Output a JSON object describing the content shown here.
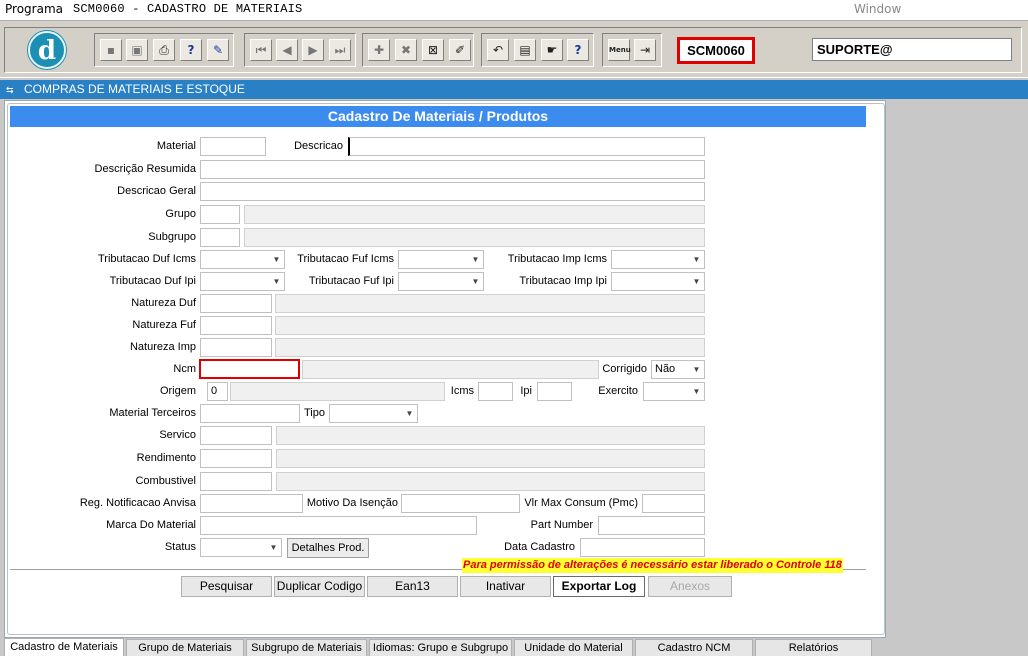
{
  "menubar": {
    "programa": "Programa",
    "title": "SCM0060 - CADASTRO DE MATERIAIS",
    "window": "Window"
  },
  "toolbar": {
    "logo_letter": "d",
    "buttons": [
      {
        "icon": "save-icon",
        "glyph": "▪"
      },
      {
        "icon": "screen-icon",
        "glyph": "▣"
      },
      {
        "icon": "print-icon",
        "glyph": "⎙"
      },
      {
        "icon": "query-icon",
        "glyph": "?"
      },
      {
        "icon": "execute-query-icon",
        "glyph": "✎"
      },
      {
        "icon": "first-record-icon",
        "glyph": "⏮"
      },
      {
        "icon": "previous-record-icon",
        "glyph": "◀"
      },
      {
        "icon": "next-record-icon",
        "glyph": "▶"
      },
      {
        "icon": "last-record-icon",
        "glyph": "⏭"
      },
      {
        "icon": "insert-record-icon",
        "glyph": "✚"
      },
      {
        "icon": "delete-record-icon",
        "glyph": "✖"
      },
      {
        "icon": "clear-record-icon",
        "glyph": "⊠"
      },
      {
        "icon": "edit-icon",
        "glyph": "✐"
      },
      {
        "icon": "undo-icon",
        "glyph": "↶"
      },
      {
        "icon": "clipboard-icon",
        "glyph": "▤"
      },
      {
        "icon": "hand-icon",
        "glyph": "☛"
      },
      {
        "icon": "help-icon",
        "glyph": "?"
      },
      {
        "icon": "menu-icon",
        "glyph": "Menu"
      },
      {
        "icon": "exit-icon",
        "glyph": "⇥"
      }
    ],
    "screen_code": "SCM0060",
    "user": "SUPORTE@"
  },
  "module_bar": {
    "title": "COMPRAS DE MATERIAIS E ESTOQUE"
  },
  "form": {
    "title": "Cadastro De Materiais / Produtos",
    "labels": {
      "material": "Material",
      "descricao": "Descricao",
      "descricao_resumida": "Descrição Resumida",
      "descricao_geral": "Descricao Geral",
      "grupo": "Grupo",
      "subgrupo": "Subgrupo",
      "trib_duf_icms": "Tributacao Duf Icms",
      "trib_fuf_icms": "Tributacao Fuf Icms",
      "trib_imp_icms": "Tributacao Imp Icms",
      "trib_duf_ipi": "Tributacao Duf Ipi",
      "trib_fuf_ipi": "Tributacao Fuf Ipi",
      "trib_imp_ipi": "Tributacao Imp Ipi",
      "natureza_duf": "Natureza Duf",
      "natureza_fuf": "Natureza Fuf",
      "natureza_imp": "Natureza Imp",
      "ncm": "Ncm",
      "corrigido": "Corrigido",
      "origem": "Origem",
      "icms": "Icms",
      "ipi": "Ipi",
      "exercicio": "Exercito",
      "material_terceiros": "Material Terceiros",
      "tipo": "Tipo",
      "servico": "Servico",
      "rendimento": "Rendimento",
      "combustivel": "Combustivel",
      "reg_anvisa": "Reg. Notificacao Anvisa",
      "motivo_isencao": "Motivo Da Isenção",
      "vlr_max_consum": "Vlr Max Consum (Pmc)",
      "marca": "Marca Do Material",
      "part_number": "Part Number",
      "status": "Status",
      "data_cadastro": "Data Cadastro"
    },
    "values": {
      "corrigido": "Não",
      "origem": "0"
    },
    "detalhes_button": "Detalhes Prod.",
    "permission_message": "Para permissão de alterações é necessário estar liberado o Controle 118"
  },
  "actions": {
    "pesquisar": "Pesquisar",
    "duplicar": "Duplicar Codigo",
    "ean13": "Ean13",
    "inativar": "Inativar",
    "exportar_log": "Exportar Log",
    "anexos": "Anexos"
  },
  "tabs": [
    "Cadastro de Materiais",
    "Grupo de Materiais",
    "Subgrupo de Materiais",
    "Idiomas: Grupo e Subgrupo",
    "Unidade do Material",
    "Cadastro NCM",
    "Relatórios"
  ]
}
